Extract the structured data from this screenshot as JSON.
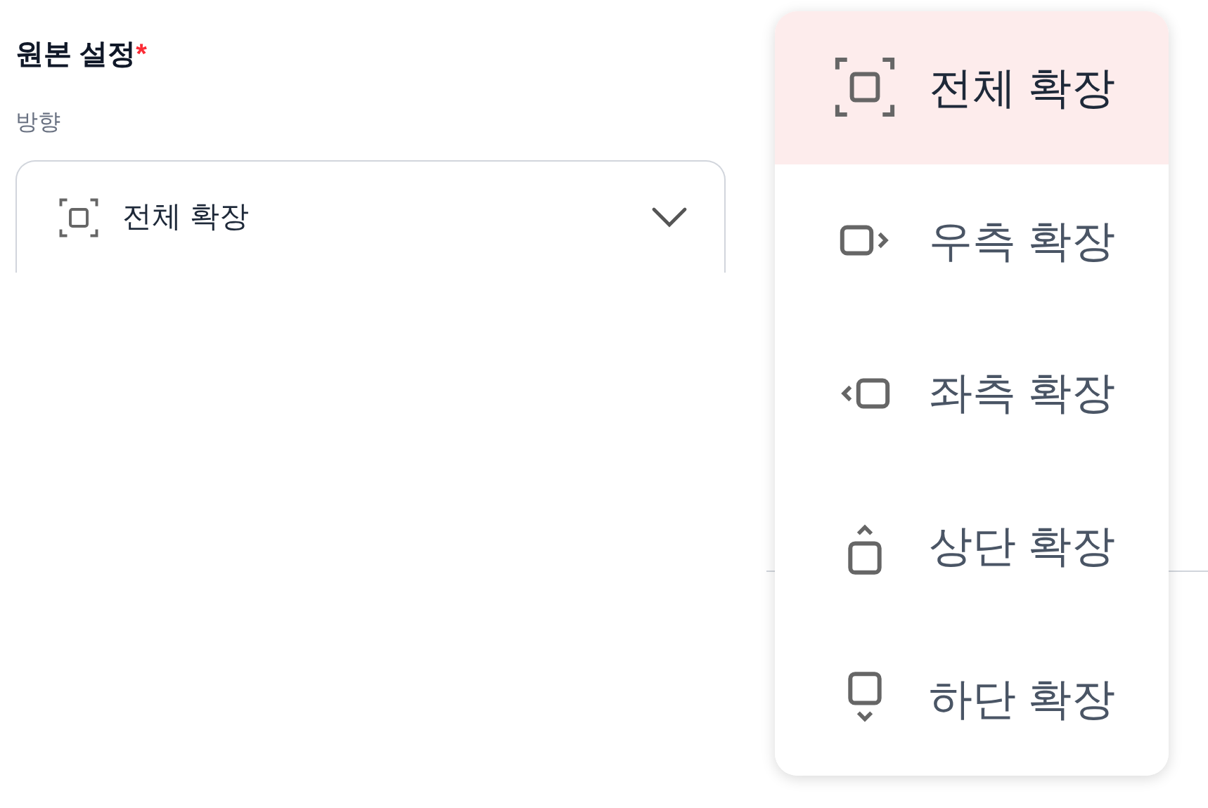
{
  "section": {
    "title": "원본 설정",
    "required_mark": "*"
  },
  "field": {
    "label": "방향",
    "value": "전체 확장"
  },
  "dropdown": {
    "items": [
      {
        "label": "전체 확장",
        "kind": "all",
        "selected": true
      },
      {
        "label": "우측 확장",
        "kind": "right",
        "selected": false
      },
      {
        "label": "좌측 확장",
        "kind": "left",
        "selected": false
      },
      {
        "label": "상단 확장",
        "kind": "top",
        "selected": false
      },
      {
        "label": "하단 확장",
        "kind": "bottom",
        "selected": false
      }
    ]
  }
}
